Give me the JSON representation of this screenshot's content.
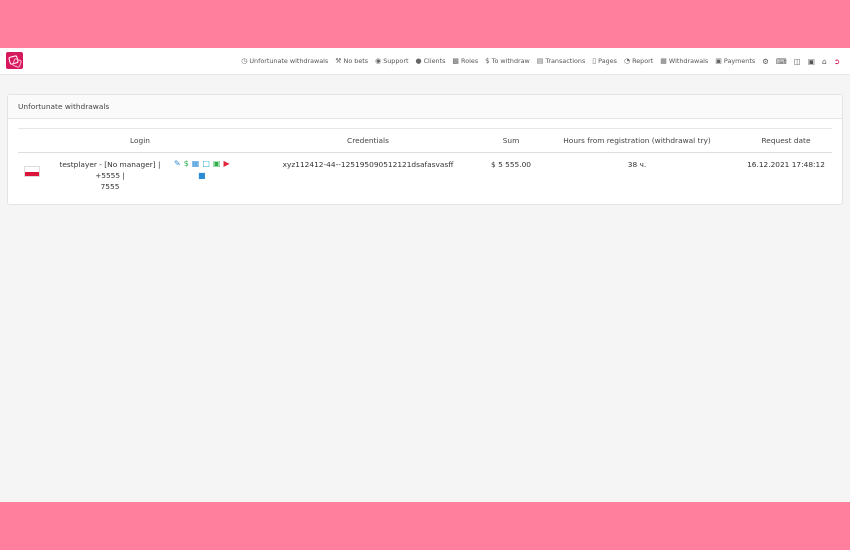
{
  "nav": {
    "items": [
      {
        "label": "Unfortunate withdrawals",
        "icon": "clock-icon"
      },
      {
        "label": "No bets",
        "icon": "wrench-icon"
      },
      {
        "label": "Support",
        "icon": "lifebuoy-icon"
      },
      {
        "label": "Clients",
        "icon": "user-icon"
      },
      {
        "label": "Roles",
        "icon": "users-icon"
      },
      {
        "label": "To withdraw",
        "icon": "dollar-icon"
      },
      {
        "label": "Transactions",
        "icon": "list-icon"
      },
      {
        "label": "Pages",
        "icon": "file-icon"
      },
      {
        "label": "Report",
        "icon": "pie-chart-icon"
      },
      {
        "label": "Withdrawals",
        "icon": "wallet-icon"
      },
      {
        "label": "Payments",
        "icon": "money-icon"
      }
    ]
  },
  "panel": {
    "title": "Unfortunate withdrawals"
  },
  "table": {
    "headers": {
      "login": "Login",
      "credentials": "Credentials",
      "sum": "Sum",
      "hours": "Hours from registration (withdrawal try)",
      "request_date": "Request date"
    },
    "rows": [
      {
        "login_line1": "testplayer - [No manager] | +5555 |",
        "login_line2": "7555",
        "credentials": "xyz112412-44--125195090512121dsafasvasff",
        "sum": "$ 5 555.00",
        "hours": "38 ч.",
        "request_date": "16.12.2021 17:48:12"
      }
    ]
  },
  "colors": {
    "accent": "#ff7f9c",
    "brand": "#d6195e"
  }
}
